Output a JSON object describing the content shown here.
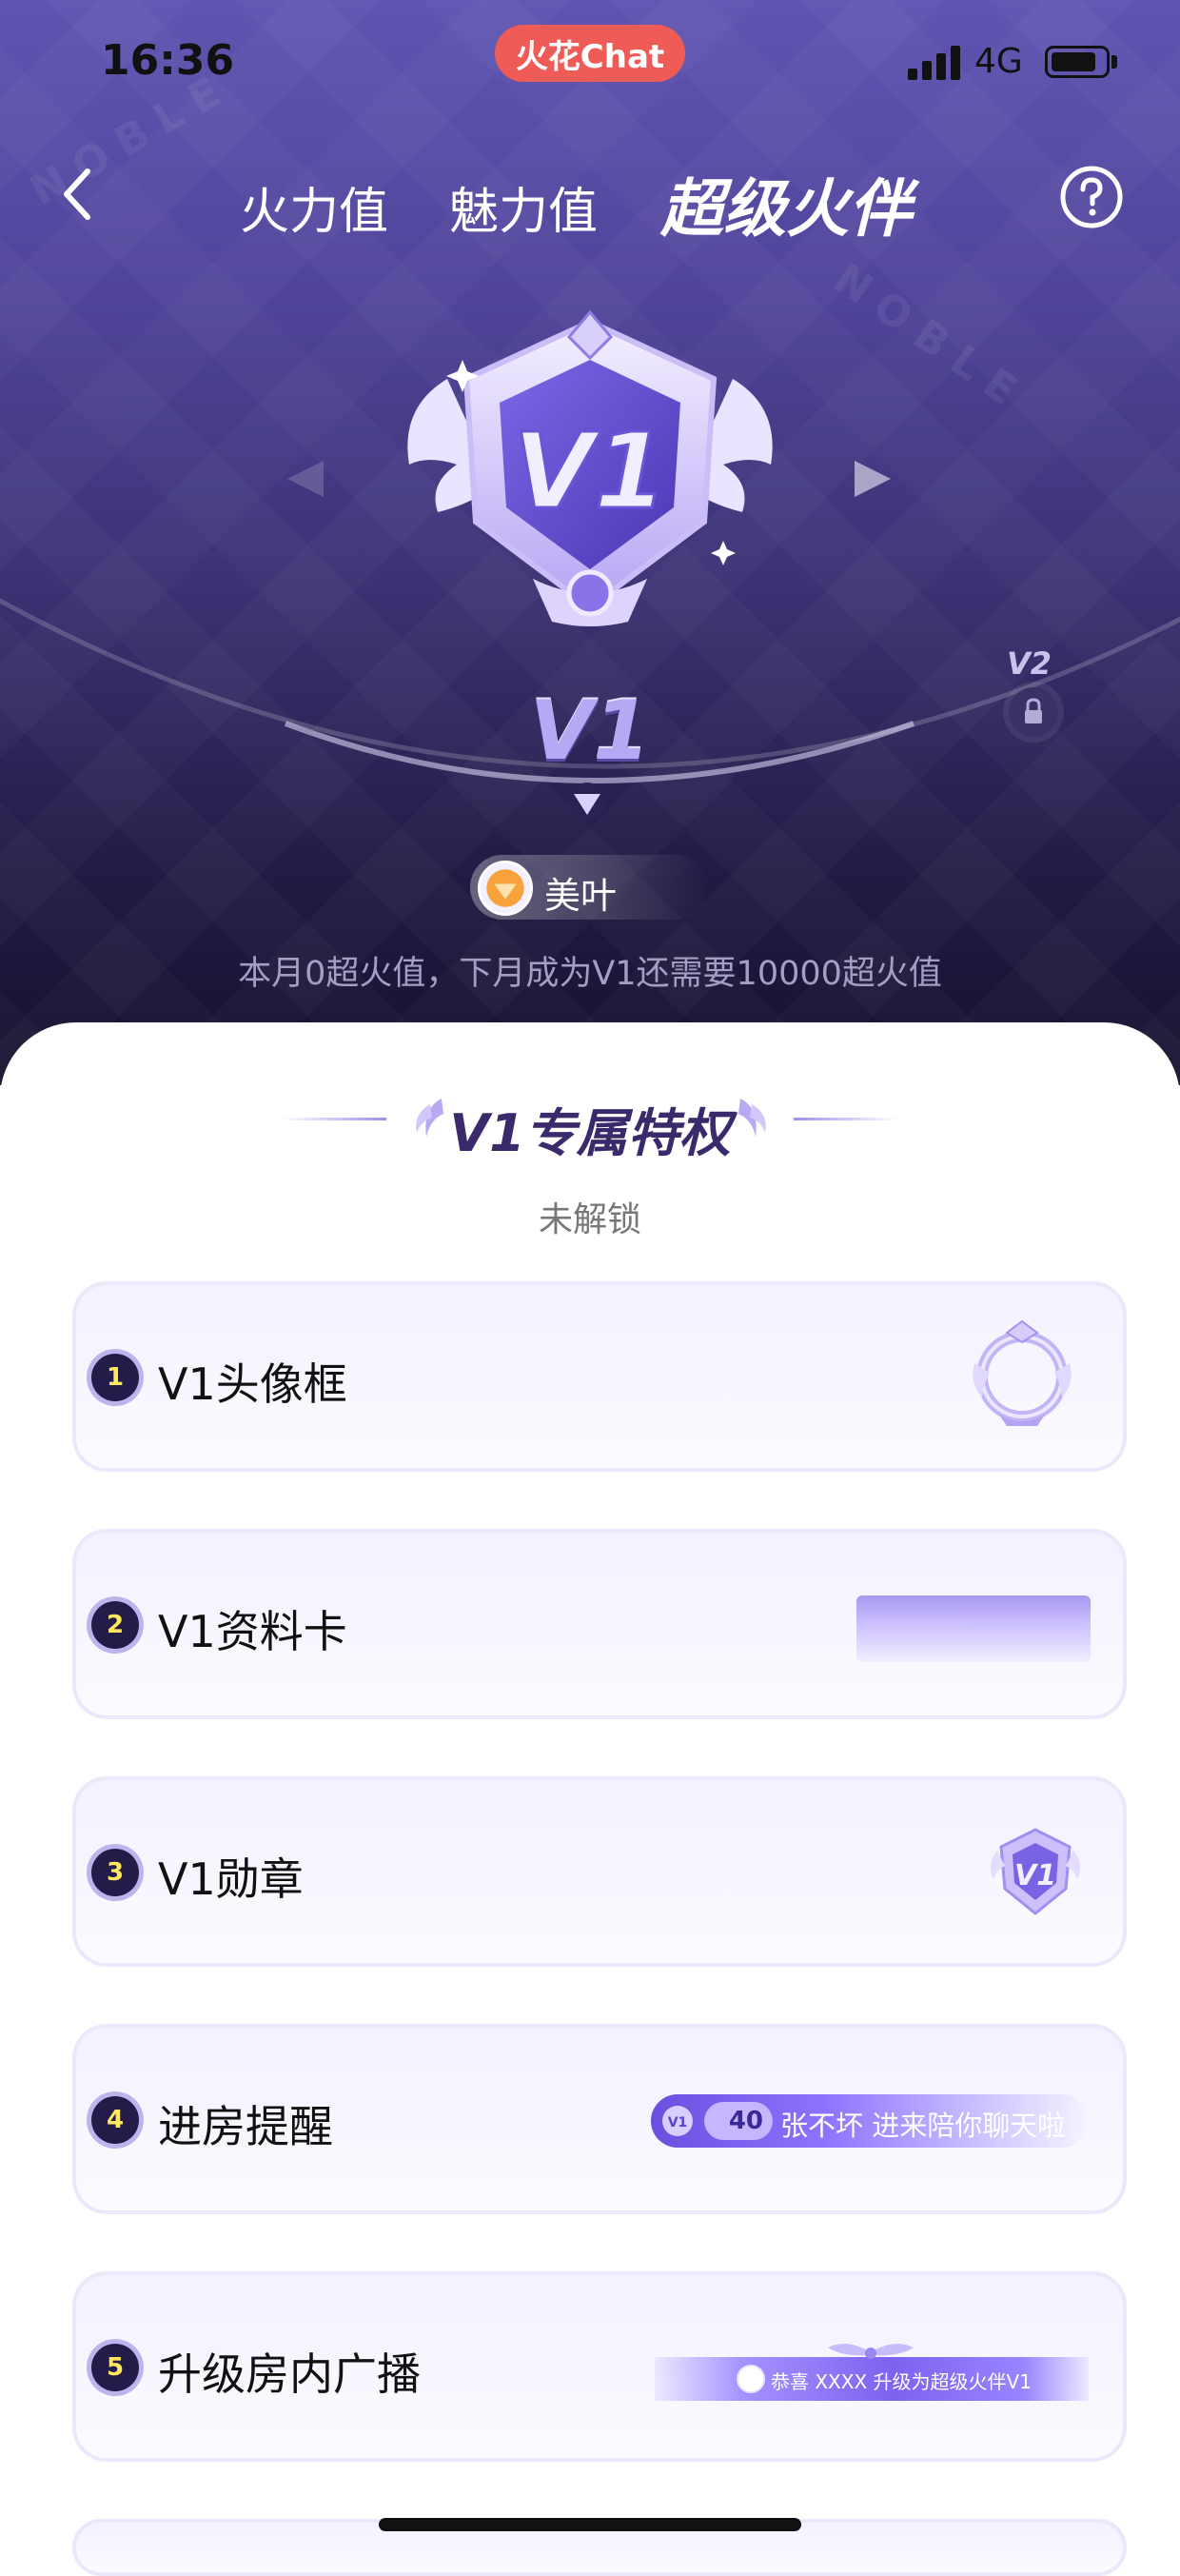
{
  "status_bar": {
    "time": "16:36",
    "app_chip": "火花Chat",
    "network": "4G",
    "signal_icon": "signal-bars-icon",
    "battery_icon": "battery-icon"
  },
  "nav": {
    "back_icon": "chevron-left-icon",
    "tabs": [
      {
        "label": "火力值",
        "active": false
      },
      {
        "label": "魅力值",
        "active": false
      },
      {
        "label": "超级火伴",
        "active": true
      }
    ],
    "help_icon": "question-circle-icon"
  },
  "level": {
    "current": "V1",
    "next": "V2",
    "next_locked": true,
    "badge_icon": "v1-medal-icon"
  },
  "user": {
    "name": "美叶"
  },
  "progress_text": "本月0超火值，下月成为V1还需要10000超火值",
  "privileges": {
    "title": "V1专属特权",
    "status": "未解锁",
    "items": [
      {
        "num": "1",
        "label": "V1头像框",
        "preview": "avatar-frame-preview"
      },
      {
        "num": "2",
        "label": "V1资料卡",
        "preview": "profile-card-preview"
      },
      {
        "num": "3",
        "label": "V1勋章",
        "preview": "medal-preview"
      },
      {
        "num": "4",
        "label": "进房提醒",
        "preview": "entry-banner-preview"
      },
      {
        "num": "5",
        "label": "升级房内广播",
        "preview": "broadcast-banner-preview"
      }
    ]
  },
  "entry_preview": {
    "level": "40",
    "text": "张不坏 进来陪你聊天啦"
  },
  "broadcast_preview": {
    "text": "恭喜 XXXX 升级为超级火伴V1"
  },
  "colors": {
    "hero_top": "#5f55b2",
    "hero_bottom": "#17112e",
    "chip": "#ef5b57",
    "accent": "#7d62f0",
    "number_badge": "#241c48",
    "number_text": "#ffe75e"
  }
}
